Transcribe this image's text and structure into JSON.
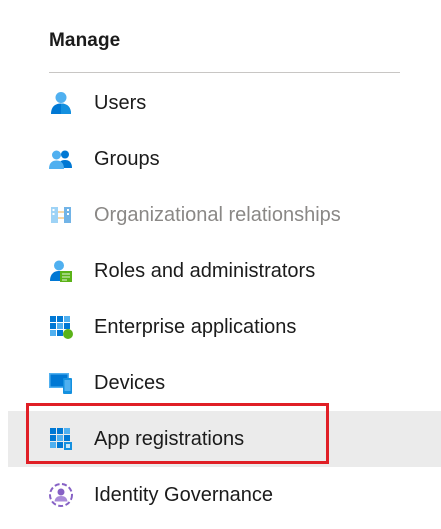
{
  "section": {
    "title": "Manage"
  },
  "nav": {
    "items": [
      {
        "label": "Users",
        "icon": "user-icon",
        "state": "normal"
      },
      {
        "label": "Groups",
        "icon": "group-icon",
        "state": "normal"
      },
      {
        "label": "Organizational relationships",
        "icon": "organizational-relationships-icon",
        "state": "disabled"
      },
      {
        "label": "Roles and administrators",
        "icon": "roles-icon",
        "state": "normal"
      },
      {
        "label": "Enterprise applications",
        "icon": "enterprise-apps-icon",
        "state": "normal"
      },
      {
        "label": "Devices",
        "icon": "devices-icon",
        "state": "normal"
      },
      {
        "label": "App registrations",
        "icon": "app-registrations-icon",
        "state": "selected"
      },
      {
        "label": "Identity Governance",
        "icon": "identity-governance-icon",
        "state": "normal"
      }
    ]
  },
  "colors": {
    "accent_blue": "#0078d4",
    "light_blue": "#50b0f0",
    "green": "#5bb318",
    "purple": "#8661c5",
    "selected_bg": "#ebebeb",
    "highlight_red": "#e01f26",
    "disabled_text": "#8a8886"
  }
}
